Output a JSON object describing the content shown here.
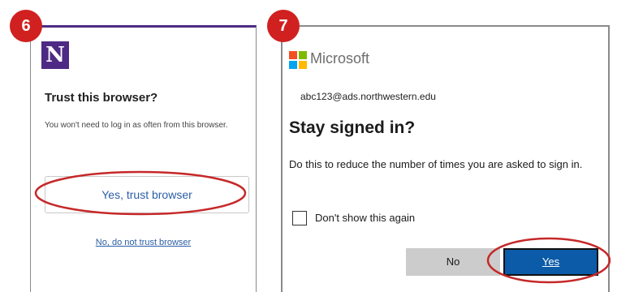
{
  "colors": {
    "badge": "#d0201f",
    "annotation": "#c62828",
    "nu_purple": "#4e2a84",
    "nu_link": "#2b5ea6",
    "ms_blue": "#0b5ba8",
    "ms_gray_button": "#cccccc",
    "ms_logo_red": "#f25022",
    "ms_logo_green": "#7fba00",
    "ms_logo_blue": "#00a4ef",
    "ms_logo_yellow": "#ffb900"
  },
  "steps": [
    {
      "number": "6"
    },
    {
      "number": "7"
    }
  ],
  "northwestern": {
    "logo_letter": "N",
    "logo_icon": "northwestern-n-logo",
    "title": "Trust this browser?",
    "description": "You won't need to log in as often from this browser.",
    "trust_button": "Yes, trust browser",
    "no_trust_link": "No, do not trust browser"
  },
  "microsoft": {
    "logo_icon": "microsoft-logo",
    "brand": "Microsoft",
    "email": "abc123@ads.northwestern.edu",
    "title": "Stay signed in?",
    "description": "Do this to reduce the number of times you are asked to sign in.",
    "checkbox_label": "Don't show this again",
    "checkbox_checked": false,
    "no_button": "No",
    "yes_button": "Yes"
  }
}
